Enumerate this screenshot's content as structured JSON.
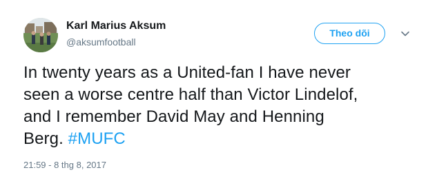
{
  "author": {
    "display_name": "Karl Marius Aksum",
    "handle": "@aksumfootball"
  },
  "follow_button": {
    "label": "Theo dõi"
  },
  "tweet": {
    "lines": [
      "In twenty years as a United-fan I have never",
      "seen a worse centre half than Victor Lindelof,",
      "and I remember David May and Henning",
      "Berg."
    ],
    "hashtag": "#MUFC",
    "timestamp": "21:59 - 8 thg 8, 2017"
  },
  "icons": {
    "avatar": "profile-photo",
    "menu": "chevron-down-icon"
  },
  "colors": {
    "accent": "#1da1f2",
    "text": "#14171a",
    "secondary": "#657786"
  }
}
